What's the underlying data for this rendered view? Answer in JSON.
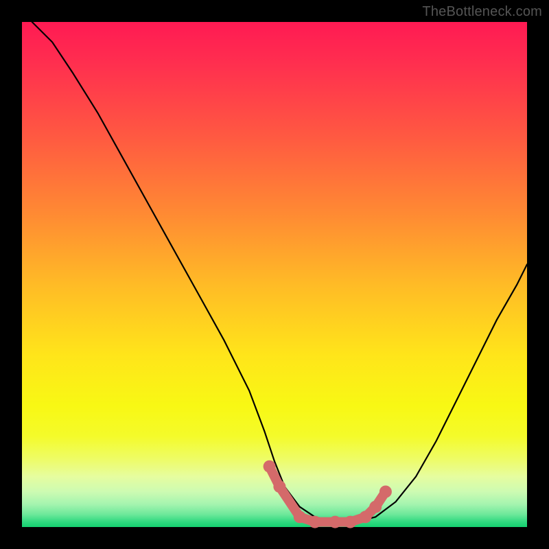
{
  "watermark": "TheBottleneck.com",
  "chart_data": {
    "type": "line",
    "title": "",
    "xlabel": "",
    "ylabel": "",
    "xlim": [
      0,
      100
    ],
    "ylim": [
      0,
      100
    ],
    "series": [
      {
        "name": "bottleneck-curve",
        "color": "#000000",
        "x": [
          2,
          6,
          10,
          15,
          20,
          25,
          30,
          35,
          40,
          45,
          48,
          50,
          52,
          55,
          58,
          62,
          66,
          70,
          74,
          78,
          82,
          86,
          90,
          94,
          98,
          100
        ],
        "y": [
          100,
          96,
          90,
          82,
          73,
          64,
          55,
          46,
          37,
          27,
          19,
          13,
          8,
          4,
          2,
          1,
          1,
          2,
          5,
          10,
          17,
          25,
          33,
          41,
          48,
          52
        ]
      },
      {
        "name": "highlight-dots",
        "color": "#d46a6a",
        "x": [
          49,
          51,
          55,
          58,
          62,
          65,
          68,
          70,
          72
        ],
        "y": [
          12,
          8,
          2,
          1,
          1,
          1,
          2,
          4,
          7
        ]
      }
    ]
  }
}
